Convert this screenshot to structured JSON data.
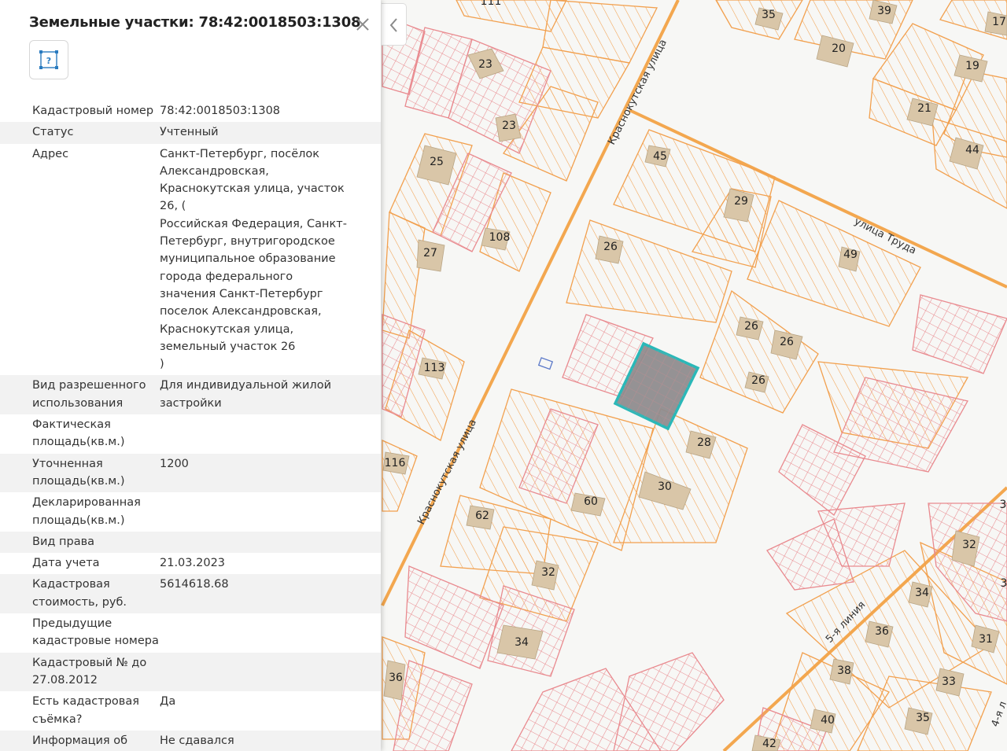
{
  "panel": {
    "title": "Земельные участки: 78:42:0018503:1308",
    "type_icon": "parcel-question-icon",
    "close_icon": "close-icon",
    "properties": [
      {
        "label": "Кадастровый номер",
        "value": "78:42:0018503:1308"
      },
      {
        "label": "Статус",
        "value": "Учтенный"
      },
      {
        "label": "Адрес",
        "value": "Санкт-Петербург, посёлок Александровская, Краснокутская улица, участок 26, (\nРоссийская Федерация, Санкт-Петербург, внутригородское муниципальное образование города федерального значения Санкт-Петербург поселок Александровская, Краснокутская улица, земельный участок 26\n)"
      },
      {
        "label": "Вид разрешенного использования",
        "value": "Для индивидуальной жилой застройки"
      },
      {
        "label": "Фактическая площадь(кв.м.)",
        "value": ""
      },
      {
        "label": "Уточненная площадь(кв.м.)",
        "value": "1200"
      },
      {
        "label": "Декларированная площадь(кв.м.)",
        "value": ""
      },
      {
        "label": "Вид права",
        "value": ""
      },
      {
        "label": "Дата учета",
        "value": "21.03.2023"
      },
      {
        "label": "Кадастровая стоимость, руб.",
        "value": "5614618.68"
      },
      {
        "label": "Предыдущие кадастровые номера",
        "value": ""
      },
      {
        "label": "Кадастровый № до 27.08.2012",
        "value": ""
      },
      {
        "label": "Есть кадастровая съёмка?",
        "value": "Да"
      },
      {
        "label": "Информация об аренде",
        "value": "Не сдавался"
      }
    ]
  },
  "collapse_icon": "chevron-left-icon",
  "map": {
    "streets": [
      "Краснокутская улица",
      "Краснокутская улица",
      "улица Труда",
      "5-я линия",
      "4-я л"
    ],
    "lot_numbers": [
      "111",
      "35",
      "39",
      "17",
      "23",
      "20",
      "19",
      "23",
      "21",
      "25",
      "45",
      "44",
      "29",
      "108",
      "26",
      "49",
      "27",
      "26",
      "26",
      "113",
      "26",
      "28",
      "116",
      "60",
      "30",
      "62",
      "32",
      "32",
      "34",
      "34",
      "36",
      "31",
      "36",
      "38",
      "33",
      "40",
      "35",
      "42",
      "3",
      "3"
    ],
    "colors": {
      "background": "#f7f7f5",
      "parcel_orange": "#f2a04e",
      "parcel_pink": "#e98a8f",
      "road": "#f3a74f",
      "building": "#d9c6a8",
      "selected_fill": "#8f8c8e",
      "selected_outline": "#2ab8b8"
    }
  }
}
